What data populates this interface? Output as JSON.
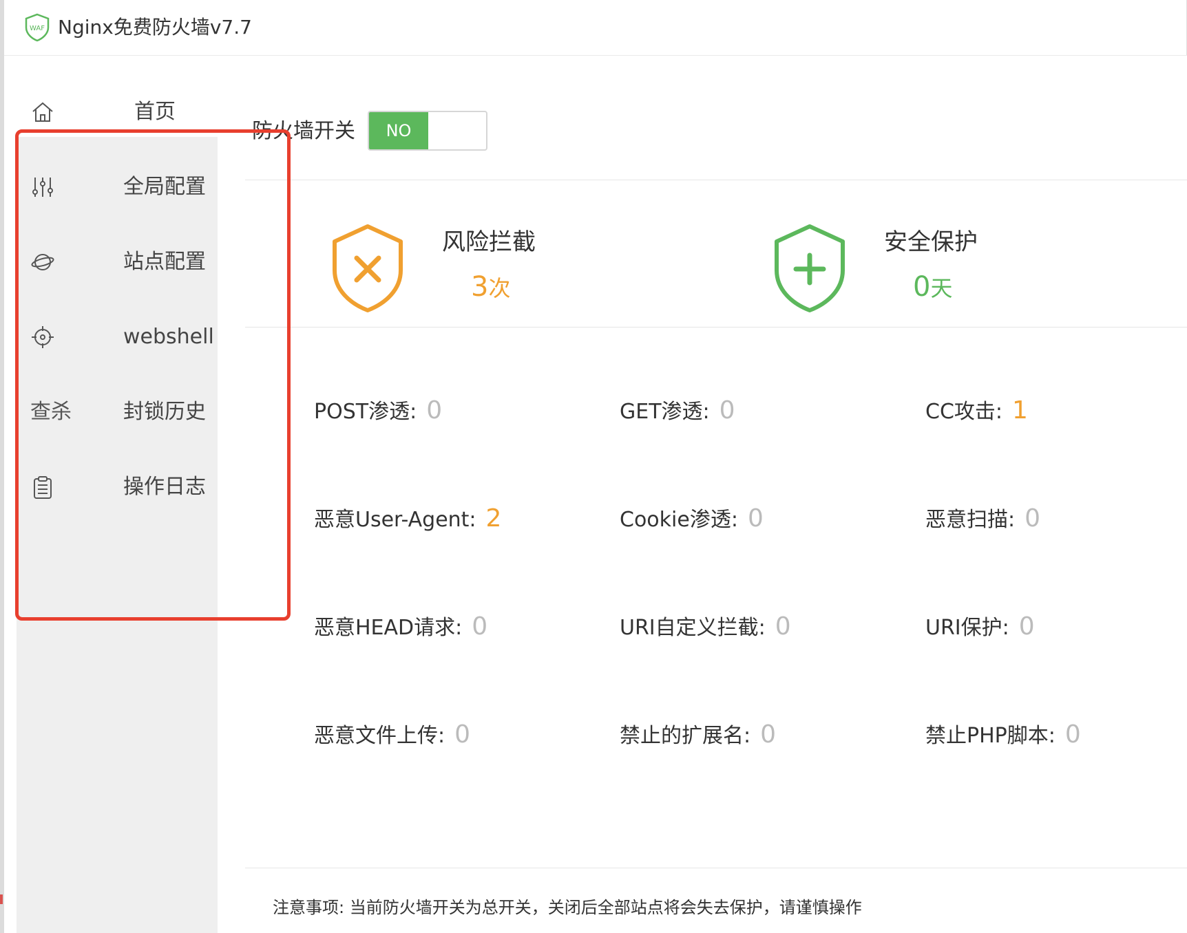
{
  "app": {
    "title": "Nginx免费防火墙v7.7",
    "logo_text": "WAF"
  },
  "sidebar": {
    "items": [
      {
        "label": "首页",
        "icon": "home-icon"
      },
      {
        "label": "全局配置",
        "icon": "sliders-icon"
      },
      {
        "label": "站点配置",
        "icon": "planet-icon"
      },
      {
        "label": "webshell",
        "icon": "target-icon"
      },
      {
        "label": "封锁历史",
        "icon": "kill-icon",
        "icon_text": "查杀"
      },
      {
        "label": "操作日志",
        "icon": "clipboard-icon"
      }
    ]
  },
  "main": {
    "switch": {
      "label": "防火墙开关",
      "state_text": "NO",
      "on": true
    },
    "stats": [
      {
        "title": "风险拦截",
        "value": "3",
        "unit": "次",
        "icon": "shield-x-icon",
        "color": "#f0a030"
      },
      {
        "title": "安全保护",
        "value": "0",
        "unit": "天",
        "icon": "shield-plus-icon",
        "color": "#5cb85c"
      }
    ],
    "metrics": [
      {
        "label": "POST渗透:",
        "value": "0"
      },
      {
        "label": "GET渗透:",
        "value": "0"
      },
      {
        "label": "CC攻击:",
        "value": "1"
      },
      {
        "label": "恶意User-Agent:",
        "value": "2"
      },
      {
        "label": "Cookie渗透:",
        "value": "0"
      },
      {
        "label": "恶意扫描:",
        "value": "0"
      },
      {
        "label": "恶意HEAD请求:",
        "value": "0"
      },
      {
        "label": "URI自定义拦截:",
        "value": "0"
      },
      {
        "label": "URI保护:",
        "value": "0"
      },
      {
        "label": "恶意文件上传:",
        "value": "0"
      },
      {
        "label": "禁止的扩展名:",
        "value": "0"
      },
      {
        "label": "禁止PHP脚本:",
        "value": "0"
      }
    ],
    "note": "注意事项: 当前防火墙开关为总开关，关闭后全部站点将会失去保护，请谨慎操作"
  },
  "colors": {
    "accent_green": "#5cb85c",
    "accent_orange": "#f0a030",
    "highlight_red": "#e83f2e"
  }
}
